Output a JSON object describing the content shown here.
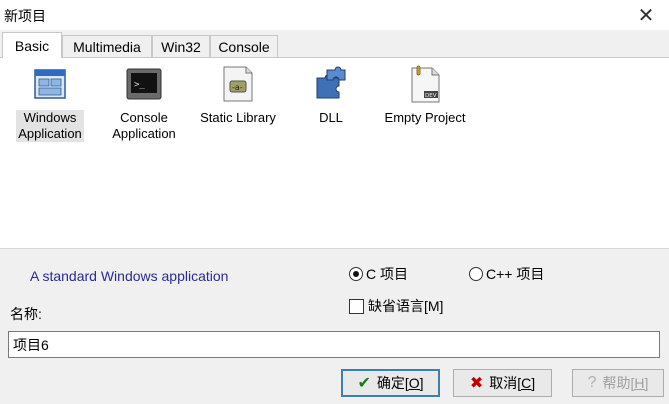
{
  "window": {
    "title": "新项目"
  },
  "tabs": [
    {
      "label": "Basic"
    },
    {
      "label": "Multimedia"
    },
    {
      "label": "Win32"
    },
    {
      "label": "Console"
    }
  ],
  "templates": [
    {
      "label": "Windows Application",
      "icon": "windows-app-icon",
      "selected": true
    },
    {
      "label": "Console Application",
      "icon": "console-app-icon"
    },
    {
      "label": "Static Library",
      "icon": "static-library-icon"
    },
    {
      "label": "DLL",
      "icon": "dll-puzzle-icon"
    },
    {
      "label": "Empty Project",
      "icon": "empty-project-icon"
    }
  ],
  "description": "A standard Windows application",
  "language": {
    "c_label": "C 项目",
    "cpp_label": "C++ 项目",
    "selected": "C"
  },
  "default_language": {
    "label": "缺省语言[M]",
    "checked": false
  },
  "name": {
    "label": "名称:",
    "value": "项目6"
  },
  "buttons": {
    "ok": {
      "text": "确定",
      "accel": "[O]"
    },
    "cancel": {
      "text": "取消",
      "accel": "[C]"
    },
    "help": {
      "text": "帮助",
      "accel": "[H]"
    }
  },
  "colors": {
    "description_text": "#2a2a9a",
    "ok_check": "#1a7a1a",
    "cancel_x": "#c00000"
  }
}
